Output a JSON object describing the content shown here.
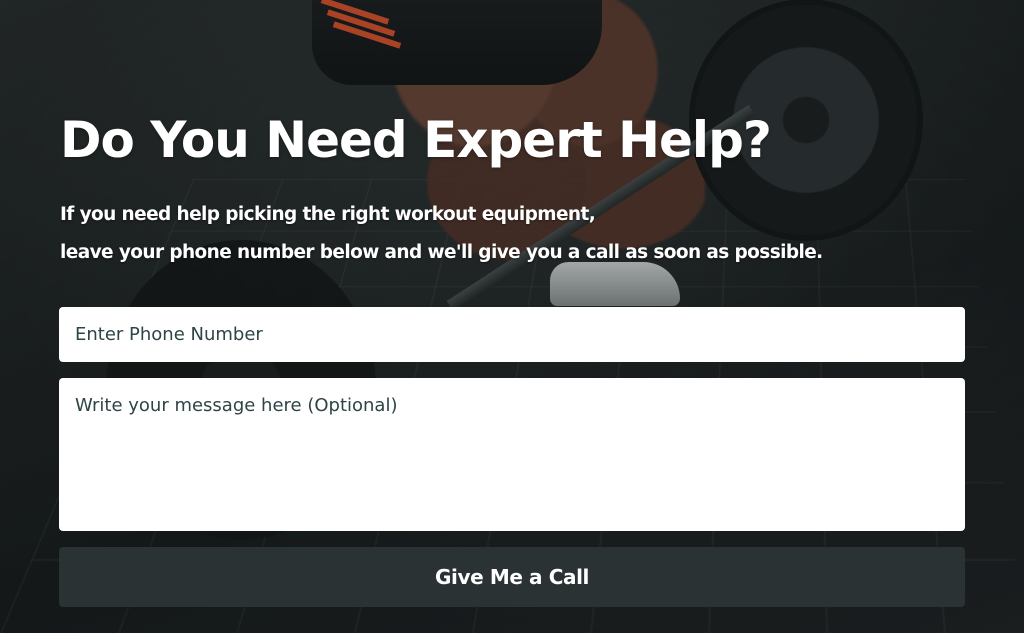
{
  "modal": {
    "heading": "Do You Need Expert Help?",
    "subtext_line1": "If you need help picking the right workout equipment,",
    "subtext_line2": "leave your phone number below and we'll give you a call as soon as possible.",
    "close_icon": "close-icon"
  },
  "form": {
    "phone_placeholder": "Enter Phone Number",
    "phone_value": "",
    "message_placeholder": "Write your message here (Optional)",
    "message_value": "",
    "submit_label": "Give Me a Call"
  },
  "colors": {
    "button_background": "#2a3234",
    "input_background": "#ffffff",
    "heading_text": "#ffffff",
    "close_icon": "#1b1e1f"
  }
}
